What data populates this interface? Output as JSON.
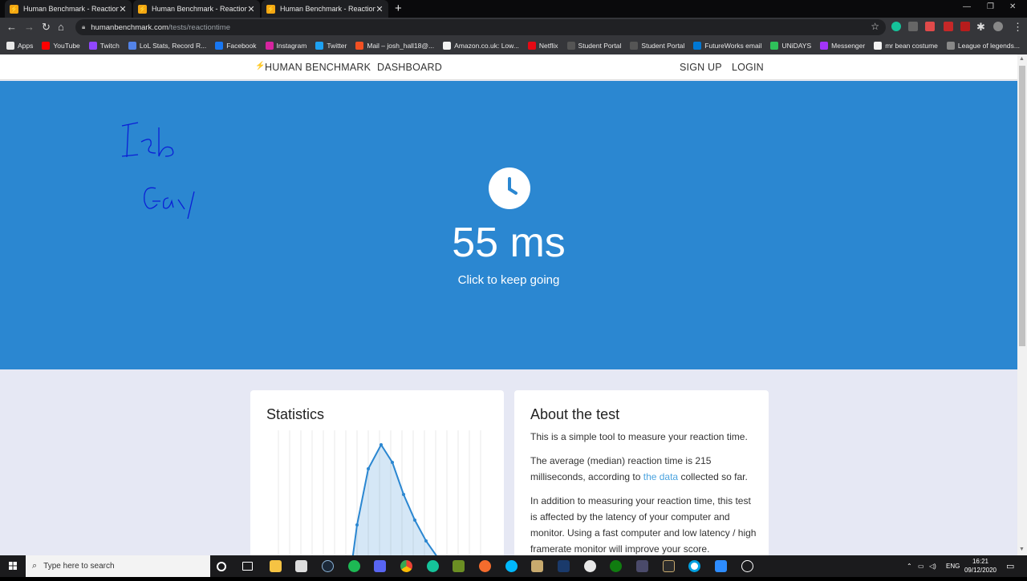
{
  "browser": {
    "tabs": [
      {
        "title": "Human Benchmark - Reaction Time"
      },
      {
        "title": "Human Benchmark - Reaction Time"
      },
      {
        "title": "Human Benchmark - Reaction Time"
      }
    ],
    "url_host": "humanbenchmark.com",
    "url_path": "/tests/reactiontime"
  },
  "bookmarks": [
    {
      "label": "Apps",
      "color": "#e8e8e8"
    },
    {
      "label": "YouTube",
      "color": "#ff0000"
    },
    {
      "label": "Twitch",
      "color": "#9146ff"
    },
    {
      "label": "LoL Stats, Record R...",
      "color": "#5383e8"
    },
    {
      "label": "Facebook",
      "color": "#1877f2"
    },
    {
      "label": "Instagram",
      "color": "#d6249f"
    },
    {
      "label": "Twitter",
      "color": "#1da1f2"
    },
    {
      "label": "Mail – josh_hall18@...",
      "color": "#f25022"
    },
    {
      "label": "Amazon.co.uk: Low...",
      "color": "#f3f3f3"
    },
    {
      "label": "Netflix",
      "color": "#e50914"
    },
    {
      "label": "Student Portal",
      "color": "#555555"
    },
    {
      "label": "Student Portal",
      "color": "#555555"
    },
    {
      "label": "FutureWorks email",
      "color": "#0078d4"
    },
    {
      "label": "UNiDAYS",
      "color": "#2fc15a"
    },
    {
      "label": "Messenger",
      "color": "#a334fa"
    },
    {
      "label": "mr bean costume",
      "color": "#f3f3f3"
    },
    {
      "label": "League of legends...",
      "color": "#888888"
    }
  ],
  "nav": {
    "brand": "HUMAN BENCHMARK",
    "dashboard": "DASHBOARD",
    "signup": "SIGN UP",
    "login": "LOGIN"
  },
  "hero": {
    "score": "55 ms",
    "prompt": "Click to keep going",
    "background": "#2b87d1"
  },
  "statistics": {
    "title": "Statistics"
  },
  "about": {
    "title": "About the test",
    "p1": "This is a simple tool to measure your reaction time.",
    "p2_before": "The average (median) reaction time is 215 milliseconds, according to ",
    "p2_link": "the data",
    "p2_after": " collected so far.",
    "p3": "In addition to measuring your reaction time, this test is affected by the latency of your computer and monitor. Using a fast computer and low latency / high framerate monitor will improve your score."
  },
  "taskbar": {
    "search_placeholder": "Type here to search",
    "language": "ENG",
    "time": "16:21",
    "date": "09/12/2020"
  }
}
